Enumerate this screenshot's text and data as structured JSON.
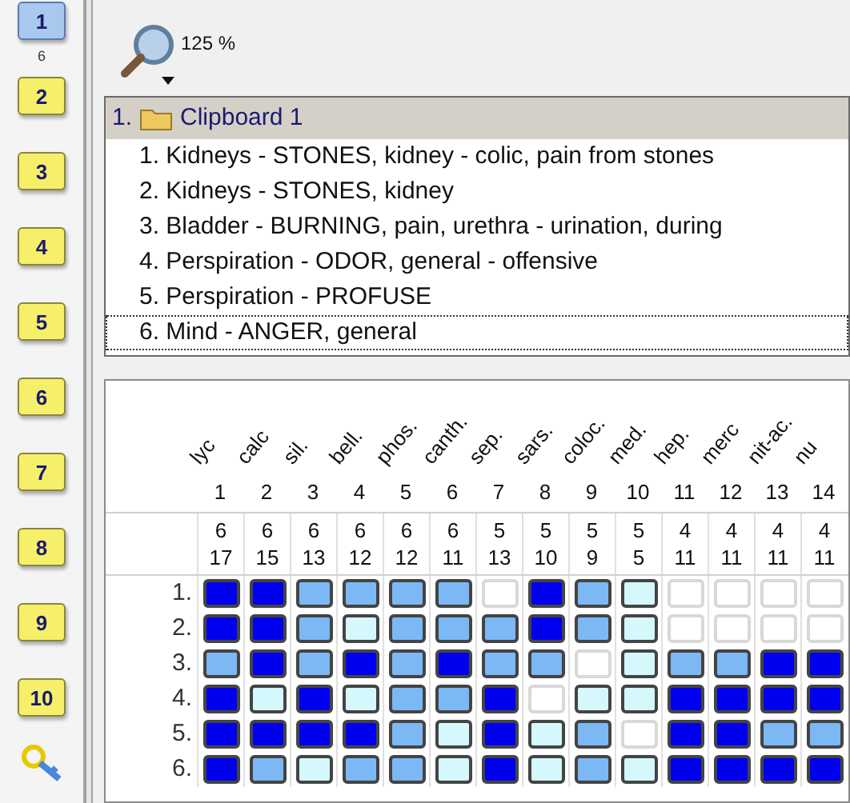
{
  "sidebar": {
    "buttons": [
      {
        "label": "1",
        "selected": true,
        "count": "6"
      },
      {
        "label": "2",
        "selected": false
      },
      {
        "label": "3",
        "selected": false
      },
      {
        "label": "4",
        "selected": false
      },
      {
        "label": "5",
        "selected": false
      },
      {
        "label": "6",
        "selected": false
      },
      {
        "label": "7",
        "selected": false
      },
      {
        "label": "8",
        "selected": false
      },
      {
        "label": "9",
        "selected": false
      },
      {
        "label": "10",
        "selected": false
      }
    ]
  },
  "toolbar": {
    "zoom": "125 %"
  },
  "clipboard": {
    "number": "1.",
    "title": "Clipboard 1",
    "items": [
      {
        "text": "1. Kidneys - STONES, kidney - colic, pain from stones",
        "selected": false
      },
      {
        "text": "2. Kidneys - STONES, kidney",
        "selected": false
      },
      {
        "text": "3. Bladder - BURNING, pain, urethra - urination, during",
        "selected": false
      },
      {
        "text": "4. Perspiration - ODOR, general - offensive",
        "selected": false
      },
      {
        "text": "5. Perspiration - PROFUSE",
        "selected": false
      },
      {
        "text": "6. Mind - ANGER, general",
        "selected": true
      }
    ]
  },
  "grid": {
    "columns": [
      {
        "name": "lyc",
        "index": "1",
        "count": "6",
        "score": "17"
      },
      {
        "name": "calc",
        "index": "2",
        "count": "6",
        "score": "15"
      },
      {
        "name": "sil.",
        "index": "3",
        "count": "6",
        "score": "13"
      },
      {
        "name": "bell.",
        "index": "4",
        "count": "6",
        "score": "12"
      },
      {
        "name": "phos.",
        "index": "5",
        "count": "6",
        "score": "12"
      },
      {
        "name": "canth.",
        "index": "6",
        "count": "6",
        "score": "11"
      },
      {
        "name": "sep.",
        "index": "7",
        "count": "5",
        "score": "13"
      },
      {
        "name": "sars.",
        "index": "8",
        "count": "5",
        "score": "10"
      },
      {
        "name": "coloc.",
        "index": "9",
        "count": "5",
        "score": "9"
      },
      {
        "name": "med.",
        "index": "10",
        "count": "5",
        "score": "5"
      },
      {
        "name": "hep.",
        "index": "11",
        "count": "4",
        "score": "11"
      },
      {
        "name": "merc",
        "index": "12",
        "count": "4",
        "score": "11"
      },
      {
        "name": "nit-ac.",
        "index": "13",
        "count": "4",
        "score": "11"
      },
      {
        "name": "nu",
        "index": "14",
        "count": "4",
        "score": "11"
      }
    ],
    "rows": [
      {
        "label": "1.",
        "cells": [
          {
            "color": "#0000ee"
          },
          {
            "color": "#0000ee"
          },
          {
            "color": "#7cb8f4"
          },
          {
            "color": "#7cb8f4"
          },
          {
            "color": "#7cb8f4"
          },
          {
            "color": "#7cb8f4"
          },
          {
            "color": "#ffffff"
          },
          {
            "color": "#0000ee"
          },
          {
            "color": "#7cb8f4"
          },
          {
            "color": "#d4f8fc"
          },
          {
            "color": "#ffffff"
          },
          {
            "color": "#ffffff"
          },
          {
            "color": "#ffffff"
          },
          {
            "color": "#ffffff"
          }
        ]
      },
      {
        "label": "2.",
        "cells": [
          {
            "color": "#0000ee"
          },
          {
            "color": "#0000ee"
          },
          {
            "color": "#7cb8f4"
          },
          {
            "color": "#d4f8fc"
          },
          {
            "color": "#7cb8f4"
          },
          {
            "color": "#7cb8f4"
          },
          {
            "color": "#7cb8f4"
          },
          {
            "color": "#0000ee"
          },
          {
            "color": "#7cb8f4"
          },
          {
            "color": "#d4f8fc"
          },
          {
            "color": "#ffffff"
          },
          {
            "color": "#ffffff"
          },
          {
            "color": "#ffffff"
          },
          {
            "color": "#ffffff"
          }
        ]
      },
      {
        "label": "3.",
        "cells": [
          {
            "color": "#7cb8f4"
          },
          {
            "color": "#0000ee"
          },
          {
            "color": "#7cb8f4"
          },
          {
            "color": "#0000ee"
          },
          {
            "color": "#7cb8f4"
          },
          {
            "color": "#0000ee"
          },
          {
            "color": "#7cb8f4"
          },
          {
            "color": "#7cb8f4"
          },
          {
            "color": "#ffffff"
          },
          {
            "color": "#d4f8fc"
          },
          {
            "color": "#7cb8f4"
          },
          {
            "color": "#7cb8f4"
          },
          {
            "color": "#0000ee"
          },
          {
            "color": "#0000ee"
          }
        ]
      },
      {
        "label": "4.",
        "cells": [
          {
            "color": "#0000ee"
          },
          {
            "color": "#d4f8fc"
          },
          {
            "color": "#0000ee"
          },
          {
            "color": "#d4f8fc"
          },
          {
            "color": "#7cb8f4"
          },
          {
            "color": "#7cb8f4"
          },
          {
            "color": "#0000ee"
          },
          {
            "color": "#ffffff"
          },
          {
            "color": "#d4f8fc"
          },
          {
            "color": "#d4f8fc"
          },
          {
            "color": "#0000ee"
          },
          {
            "color": "#0000ee"
          },
          {
            "color": "#0000ee"
          },
          {
            "color": "#0000ee"
          }
        ]
      },
      {
        "label": "5.",
        "cells": [
          {
            "color": "#0000ee"
          },
          {
            "color": "#0000ee"
          },
          {
            "color": "#0000ee"
          },
          {
            "color": "#0000ee"
          },
          {
            "color": "#7cb8f4"
          },
          {
            "color": "#d4f8fc"
          },
          {
            "color": "#0000ee"
          },
          {
            "color": "#d4f8fc"
          },
          {
            "color": "#7cb8f4"
          },
          {
            "color": "#ffffff"
          },
          {
            "color": "#0000ee"
          },
          {
            "color": "#0000ee"
          },
          {
            "color": "#7cb8f4"
          },
          {
            "color": "#7cb8f4"
          }
        ]
      },
      {
        "label": "6.",
        "cells": [
          {
            "color": "#0000ee"
          },
          {
            "color": "#7cb8f4"
          },
          {
            "color": "#d4f8fc"
          },
          {
            "color": "#7cb8f4"
          },
          {
            "color": "#7cb8f4"
          },
          {
            "color": "#d4f8fc"
          },
          {
            "color": "#0000ee"
          },
          {
            "color": "#d4f8fc"
          },
          {
            "color": "#7cb8f4"
          },
          {
            "color": "#d4f8fc"
          },
          {
            "color": "#0000ee"
          },
          {
            "color": "#0000ee"
          },
          {
            "color": "#0000ee"
          },
          {
            "color": "#0000ee"
          }
        ]
      }
    ]
  }
}
